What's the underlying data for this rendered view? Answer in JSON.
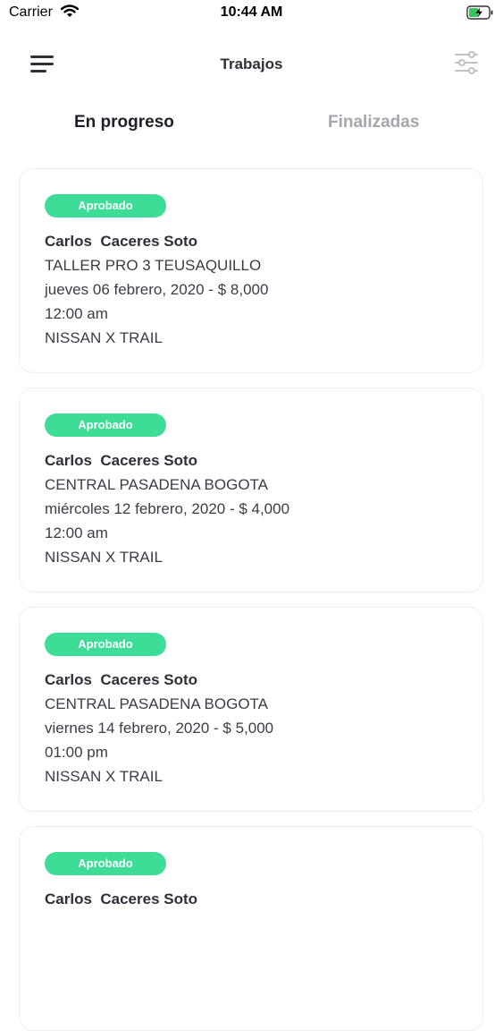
{
  "status_bar": {
    "carrier": "Carrier",
    "time": "10:44 AM"
  },
  "nav": {
    "title": "Trabajos",
    "menu_icon": "hamburger-menu-icon",
    "filter_icon": "sliders-filter-icon"
  },
  "tabs": [
    {
      "label": "En progreso",
      "active": true
    },
    {
      "label": "Finalizadas",
      "active": false
    }
  ],
  "colors": {
    "badge": "#3ddc97",
    "text": "#2d2f3a",
    "tab_inactive": "#a3a7ae"
  },
  "jobs": [
    {
      "status": "Aprobado",
      "name": "Carlos  Caceres Soto",
      "workshop": "TALLER PRO 3 TEUSAQUILLO",
      "date_price": "jueves 06 febrero, 2020 - $ 8,000",
      "time": "12:00 am",
      "vehicle": "NISSAN X TRAIL"
    },
    {
      "status": "Aprobado",
      "name": "Carlos  Caceres Soto",
      "workshop": "CENTRAL PASADENA BOGOTA",
      "date_price": "miércoles 12 febrero, 2020 - $ 4,000",
      "time": "12:00 am",
      "vehicle": "NISSAN X TRAIL"
    },
    {
      "status": "Aprobado",
      "name": "Carlos  Caceres Soto",
      "workshop": "CENTRAL PASADENA BOGOTA",
      "date_price": "viernes 14 febrero, 2020 - $ 5,000",
      "time": "01:00 pm",
      "vehicle": "NISSAN X TRAIL"
    },
    {
      "status": "Aprobado",
      "name": "Carlos  Caceres Soto"
    }
  ]
}
